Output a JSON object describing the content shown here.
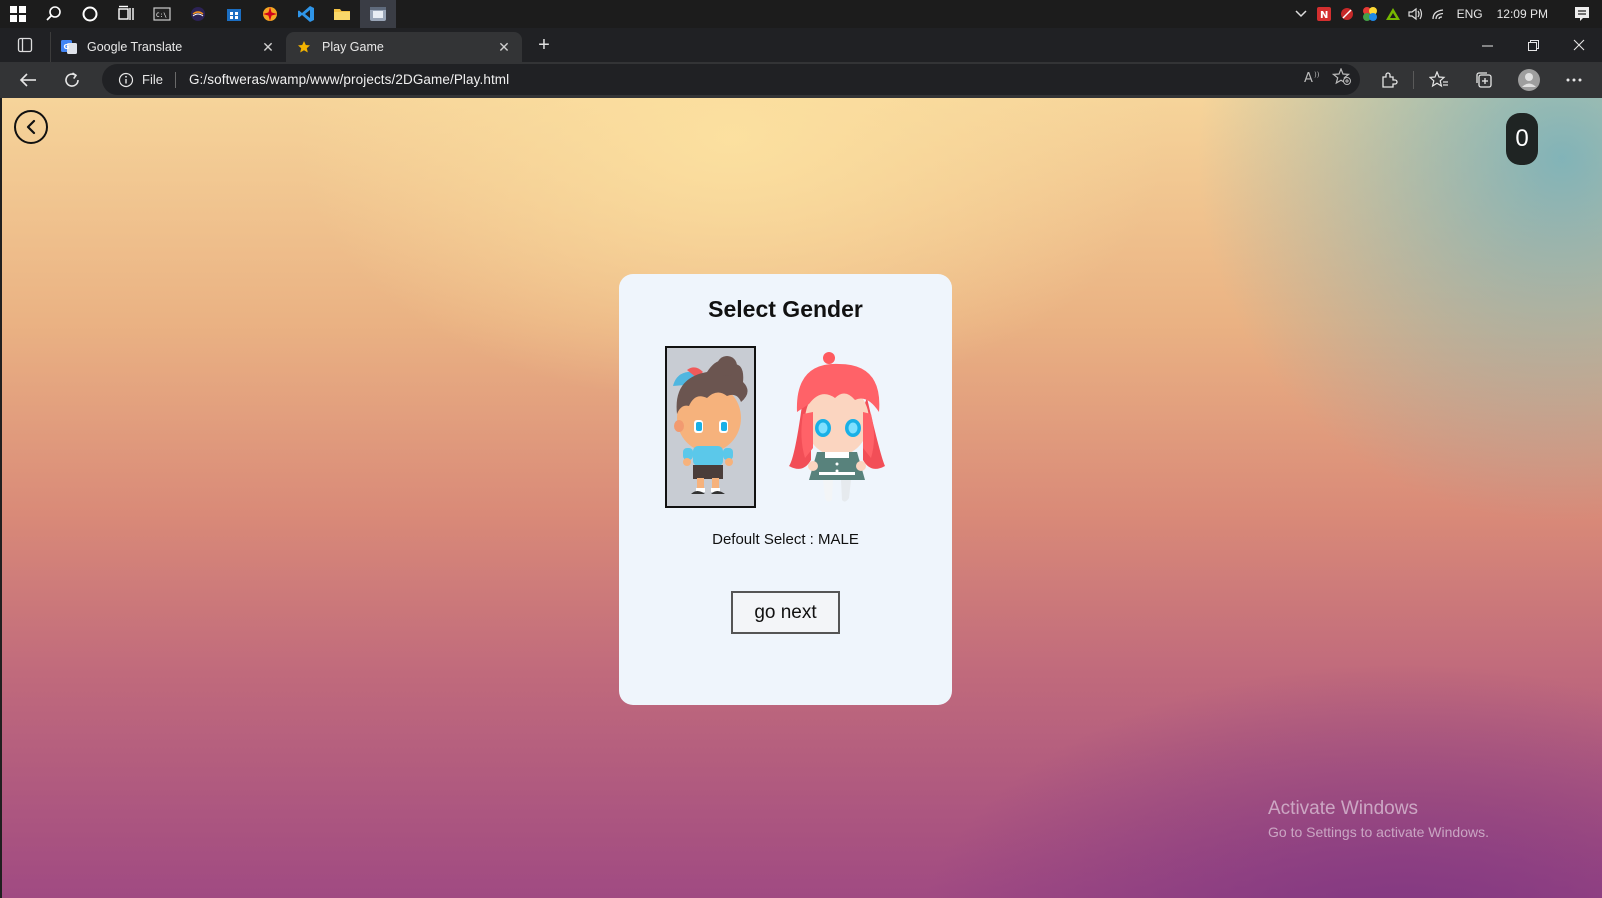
{
  "taskbar": {
    "apps": [
      "windows-start-icon",
      "search-icon",
      "cortana-icon",
      "task-view-icon",
      "terminal-icon",
      "eclipse-icon",
      "store-icon",
      "app-orange-icon",
      "vscode-icon",
      "file-explorer-icon",
      "edge-browser-icon"
    ],
    "language": "ENG",
    "clock": "12:09 PM"
  },
  "browser": {
    "tabs": [
      {
        "title": "Google Translate",
        "favicon": "google-translate-icon"
      },
      {
        "title": "Play Game",
        "favicon": "star-icon"
      }
    ],
    "address": {
      "scheme_label": "File",
      "url": "G:/softweras/wamp/www/projects/2DGame/Play.html"
    }
  },
  "page": {
    "score": "0",
    "card_title": "Select Gender",
    "default_text": "Defoult Select : MALE",
    "go_next_label": "go next"
  },
  "watermark": {
    "line1": "Activate Windows",
    "line2": "Go to Settings to activate Windows."
  },
  "colors": {
    "card_bg": "#eff5fc",
    "score_bg": "#1f2423",
    "selected_bg": "#c8ccd3"
  }
}
